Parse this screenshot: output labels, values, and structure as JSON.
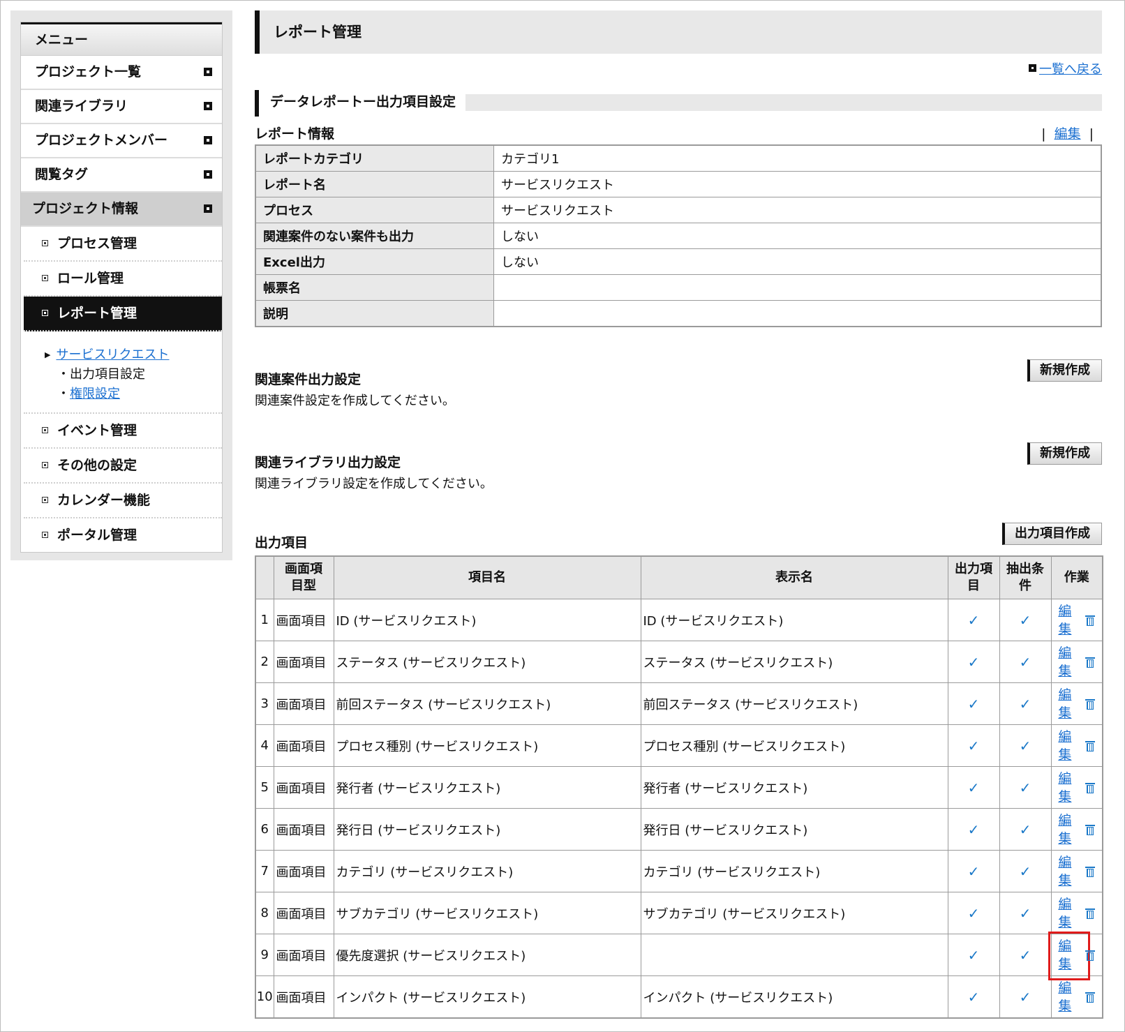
{
  "sidebar": {
    "header": "メニュー",
    "items": [
      {
        "label": "プロジェクト一覧"
      },
      {
        "label": "関連ライブラリ"
      },
      {
        "label": "プロジェクトメンバー"
      },
      {
        "label": "閲覧タグ"
      },
      {
        "label": "プロジェクト情報"
      }
    ],
    "sub_items": [
      {
        "label": "プロセス管理"
      },
      {
        "label": "ロール管理"
      },
      {
        "label": "レポート管理"
      }
    ],
    "tree": {
      "link": "サービスリクエスト",
      "current": "・出力項目設定",
      "bullet": "・",
      "perm": "権限設定"
    },
    "sub_items_after": [
      {
        "label": "イベント管理"
      },
      {
        "label": "その他の設定"
      },
      {
        "label": "カレンダー機能"
      },
      {
        "label": "ポータル管理"
      }
    ]
  },
  "main": {
    "title": "レポート管理",
    "back_link": "一覧へ戻る",
    "section_title": "データレポートー出力項目設定",
    "report_info_label": "レポート情報",
    "edit_label": "編集",
    "pipe": "|",
    "info_rows": [
      {
        "key": "レポートカテゴリ",
        "value": "カテゴリ1"
      },
      {
        "key": "レポート名",
        "value": "サービスリクエスト"
      },
      {
        "key": "プロセス",
        "value": "サービスリクエスト"
      },
      {
        "key": "関連案件のない案件も出力",
        "value": "しない"
      },
      {
        "key": "Excel出力",
        "value": "しない"
      },
      {
        "key": "帳票名",
        "value": ""
      },
      {
        "key": "説明",
        "value": ""
      }
    ],
    "related_case": {
      "title": "関連案件出力設定",
      "desc": "関連案件設定を作成してください。",
      "button": "新規作成"
    },
    "related_lib": {
      "title": "関連ライブラリ出力設定",
      "desc": "関連ライブラリ設定を作成してください。",
      "button": "新規作成"
    },
    "output": {
      "title": "出力項目",
      "button": "出力項目作成",
      "headers": {
        "type_l1": "画面項",
        "type_l2": "目型",
        "name": "項目名",
        "display": "表示名",
        "out_l1": "出力項",
        "out_l2": "目",
        "ext_l1": "抽出条",
        "ext_l2": "件",
        "ops": "作業"
      },
      "check": "✓",
      "edit_l1": "編",
      "edit_l2": "集",
      "rows": [
        {
          "no": "1",
          "type": "画面項目",
          "name": "ID (サービスリクエスト)",
          "display": "ID (サービスリクエスト)"
        },
        {
          "no": "2",
          "type": "画面項目",
          "name": "ステータス (サービスリクエスト)",
          "display": "ステータス (サービスリクエスト)"
        },
        {
          "no": "3",
          "type": "画面項目",
          "name": "前回ステータス (サービスリクエスト)",
          "display": "前回ステータス (サービスリクエスト)"
        },
        {
          "no": "4",
          "type": "画面項目",
          "name": "プロセス種別 (サービスリクエスト)",
          "display": "プロセス種別 (サービスリクエスト)"
        },
        {
          "no": "5",
          "type": "画面項目",
          "name": "発行者 (サービスリクエスト)",
          "display": "発行者 (サービスリクエスト)"
        },
        {
          "no": "6",
          "type": "画面項目",
          "name": "発行日 (サービスリクエスト)",
          "display": "発行日 (サービスリクエスト)"
        },
        {
          "no": "7",
          "type": "画面項目",
          "name": "カテゴリ (サービスリクエスト)",
          "display": "カテゴリ (サービスリクエスト)"
        },
        {
          "no": "8",
          "type": "画面項目",
          "name": "サブカテゴリ (サービスリクエスト)",
          "display": "サブカテゴリ (サービスリクエスト)"
        },
        {
          "no": "9",
          "type": "画面項目",
          "name": "優先度選択 (サービスリクエスト)",
          "display": ""
        },
        {
          "no": "10",
          "type": "画面項目",
          "name": "インパクト (サービスリクエスト)",
          "display": "インパクト (サービスリクエスト)"
        }
      ]
    }
  },
  "colors": {
    "link": "#1a6fd0",
    "highlight": "#e01b1b",
    "check": "#1a78c8"
  }
}
